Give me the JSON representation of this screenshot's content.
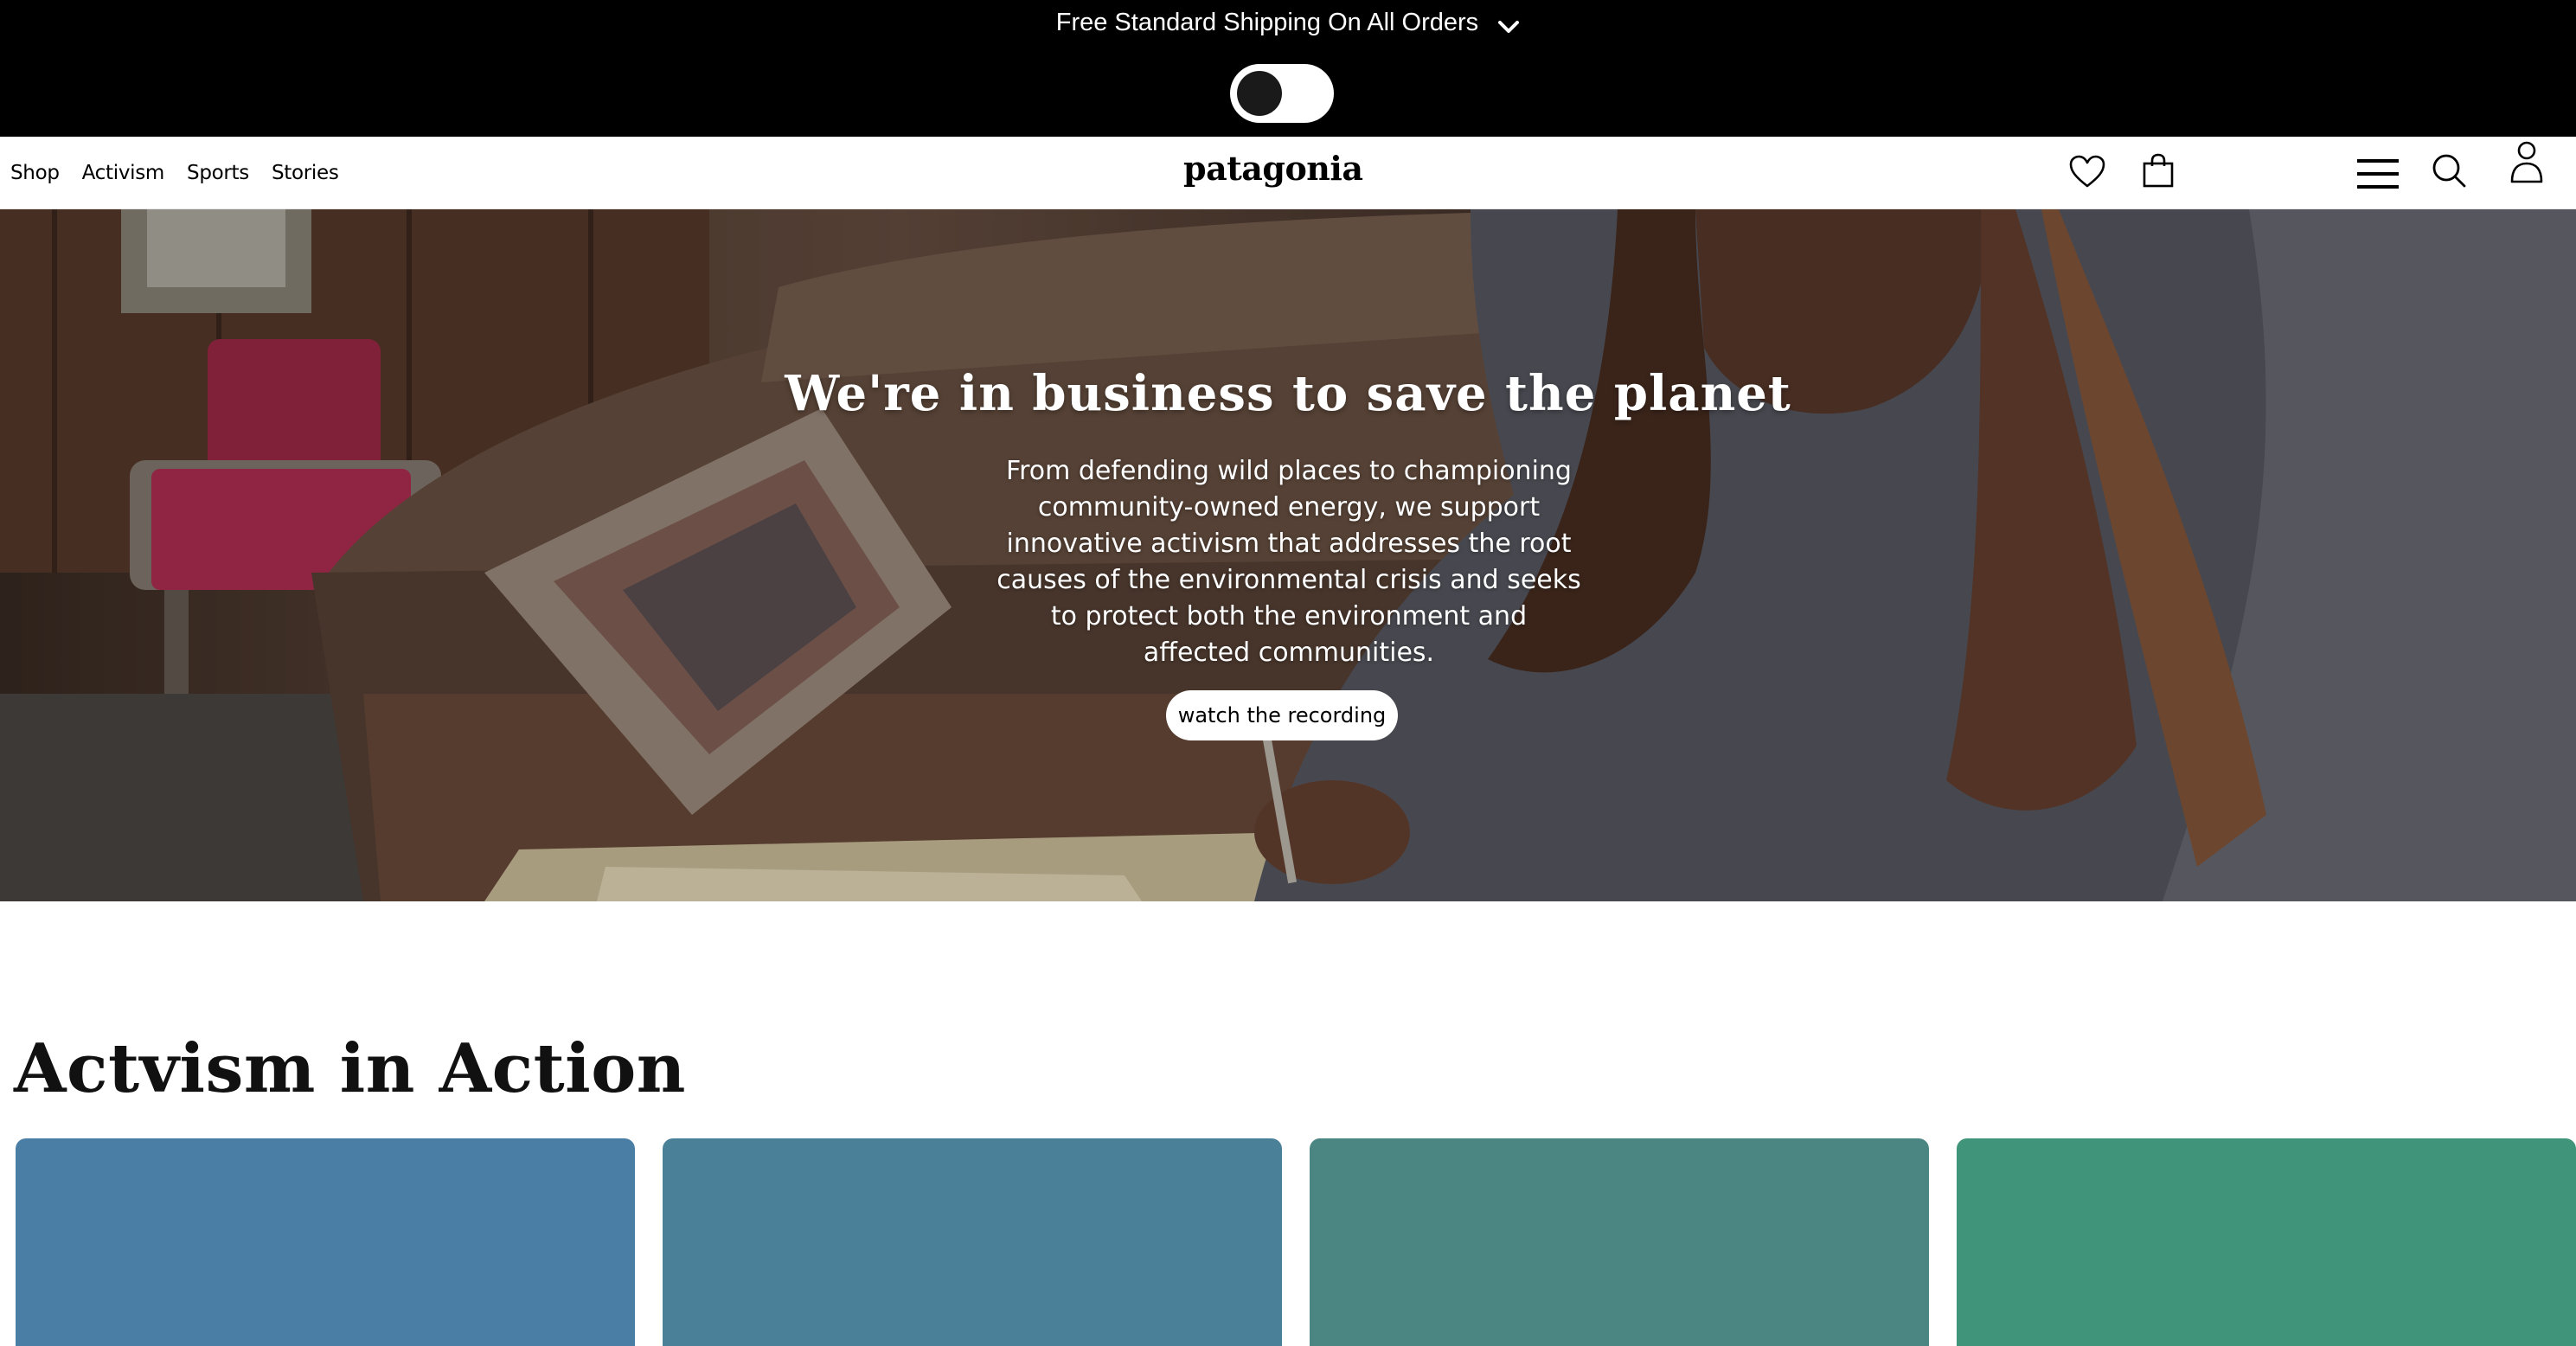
{
  "promo": {
    "text": "Free Standard Shipping On All Orders",
    "chevron_icon": "chevron-down-icon",
    "toggle_icon": "toggle-switch"
  },
  "header": {
    "nav": [
      "Shop",
      "Activism",
      "Sports",
      "Stories"
    ],
    "logo": "patagonia",
    "icons": [
      "heart-icon",
      "bag-icon",
      "menu-icon",
      "search-icon",
      "account-icon"
    ]
  },
  "hero": {
    "title": "We're in business to save the planet",
    "body": "From defending wild places to championing community-owned energy, we support innovative activism that addresses the root causes of the environmental crisis and seeks to protect both the environment and affected communities.",
    "cta": "watch the recording"
  },
  "section": {
    "title": "Actvism in Action",
    "cards": [
      {
        "color": "#4a7ea5"
      },
      {
        "color": "#4a8098"
      },
      {
        "color": "#4b8682"
      },
      {
        "color": "#3f9479"
      }
    ]
  }
}
